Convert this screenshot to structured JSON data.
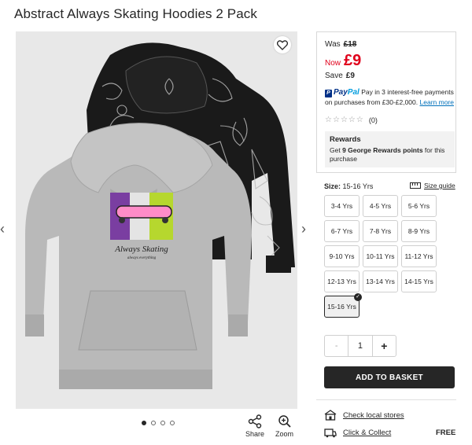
{
  "product": {
    "title": "Abstract Always Skating Hoodies 2 Pack"
  },
  "pricing": {
    "was_label": "Was",
    "was_price": "£18",
    "now_label": "Now",
    "now_price": "£9",
    "save_label": "Save",
    "save_amount": "£9"
  },
  "paypal": {
    "logo_part1": "Pay",
    "logo_part2": "Pal",
    "text": "Pay in 3 interest-free payments on purchases from £30-£2,000.",
    "link": "Learn more"
  },
  "reviews": {
    "count": "(0)",
    "rating": 0,
    "max": 5
  },
  "rewards": {
    "title": "Rewards",
    "prefix": "Get ",
    "points": "9 George Rewards points",
    "suffix": " for this purchase"
  },
  "size": {
    "label": "Size:",
    "selected": "15-16 Yrs",
    "guide": "Size guide",
    "options": [
      "3-4 Yrs",
      "4-5 Yrs",
      "5-6 Yrs",
      "6-7 Yrs",
      "7-8 Yrs",
      "8-9 Yrs",
      "9-10 Yrs",
      "10-11 Yrs",
      "11-12 Yrs",
      "12-13 Yrs",
      "13-14 Yrs",
      "14-15 Yrs",
      "15-16 Yrs"
    ]
  },
  "quantity": {
    "minus": "-",
    "value": "1",
    "plus": "+"
  },
  "basket": {
    "label": "ADD TO BASKET"
  },
  "delivery": {
    "store_label": "Check local stores",
    "click_label": "Click & Collect",
    "click_price": "FREE"
  },
  "gallery": {
    "share_label": "Share",
    "zoom_label": "Zoom",
    "slide_count": 4,
    "active_slide": 0,
    "print_text": "Always Skating",
    "print_subtext": "always everything"
  },
  "colors": {
    "price_red": "#e0001b",
    "dark": "#262626",
    "paypal_blue": "#003087",
    "paypal_light": "#009cde",
    "gallery_bg": "#e8e8e8"
  }
}
